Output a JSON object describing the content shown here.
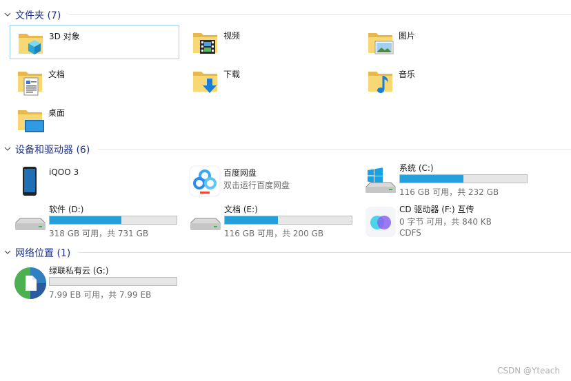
{
  "groups": {
    "folders": {
      "title": "文件夹 (7)"
    },
    "devices": {
      "title": "设备和驱动器 (6)"
    },
    "network": {
      "title": "网络位置 (1)"
    }
  },
  "folders": [
    {
      "name": "3D 对象",
      "icon": "3d-objects-icon"
    },
    {
      "name": "视频",
      "icon": "videos-icon"
    },
    {
      "name": "图片",
      "icon": "pictures-icon"
    },
    {
      "name": "文档",
      "icon": "documents-icon"
    },
    {
      "name": "下载",
      "icon": "downloads-icon"
    },
    {
      "name": "音乐",
      "icon": "music-icon"
    },
    {
      "name": "桌面",
      "icon": "desktop-icon"
    }
  ],
  "devices": {
    "phone": {
      "name": "iQOO 3",
      "icon": "phone-icon"
    },
    "baidu": {
      "name": "百度网盘",
      "subtitle": "双击运行百度网盘",
      "icon": "baidu-netdisk-icon"
    },
    "c": {
      "name": "系统 (C:)",
      "info": "116 GB 可用，共 232 GB",
      "used_fraction": 0.5
    },
    "d": {
      "name": "软件 (D:)",
      "info": "318 GB 可用，共 731 GB",
      "used_fraction": 0.565
    },
    "e": {
      "name": "文档 (E:)",
      "info": "116 GB 可用，共 200 GB",
      "used_fraction": 0.42
    },
    "f": {
      "name": "CD 驱动器 (F:) 互传",
      "info": "0 字节 可用，共 840 KB",
      "fs": "CDFS"
    }
  },
  "network": {
    "g": {
      "name": "绿联私有云 (G:)",
      "info": "7.99 EB 可用，共 7.99 EB",
      "used_fraction": 0.0
    }
  },
  "watermark": "CSDN @Yteach",
  "colors": {
    "header": "#1e3287",
    "bar_fill": "#26a0da",
    "selected_border": "#99d1ef"
  }
}
